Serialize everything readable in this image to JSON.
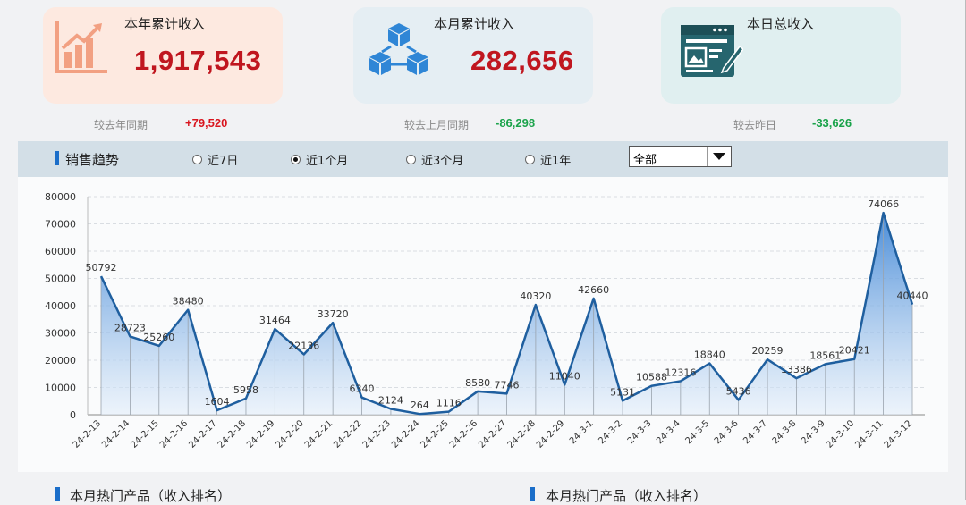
{
  "kpis": {
    "year": {
      "title": "本年累计收入",
      "value": "1,917,543",
      "cmp_label": "较去年同期",
      "cmp_value": "+79,520"
    },
    "month": {
      "title": "本月累计收入",
      "value": "282,656",
      "cmp_label": "较去上月同期",
      "cmp_value": "-86,298"
    },
    "day": {
      "title": "本日总收入",
      "value": "",
      "cmp_label": "较去昨日",
      "cmp_value": "-33,626"
    }
  },
  "colors": {
    "kpi_value": "#c0161f",
    "positive": "#d9151e",
    "negative": "#1aa34a",
    "line": "#1f5f9f",
    "accent": "#1b6ec9"
  },
  "icons": {
    "year": "bar-chart-growth-icon",
    "month": "cubes-network-icon",
    "day": "document-edit-icon"
  },
  "filter": {
    "title": "销售趋势",
    "options": [
      {
        "label": "近7日",
        "checked": false
      },
      {
        "label": "近1个月",
        "checked": true
      },
      {
        "label": "近3个月",
        "checked": false
      },
      {
        "label": "近1年",
        "checked": false
      }
    ],
    "select_value": "全部"
  },
  "chart_data": {
    "type": "area",
    "x": [
      "24-2-13",
      "24-2-14",
      "24-2-15",
      "24-2-16",
      "24-2-17",
      "24-2-18",
      "24-2-19",
      "24-2-20",
      "24-2-21",
      "24-2-22",
      "24-2-23",
      "24-2-24",
      "24-2-25",
      "24-2-26",
      "24-2-27",
      "24-2-28",
      "24-2-29",
      "24-3-1",
      "24-3-2",
      "24-3-3",
      "24-3-4",
      "24-3-5",
      "24-3-6",
      "24-3-7",
      "24-3-8",
      "24-3-9",
      "24-3-10",
      "24-3-11",
      "24-3-12"
    ],
    "values": [
      50792,
      28723,
      25260,
      38480,
      1604,
      5958,
      31464,
      22136,
      33720,
      6340,
      2124,
      264,
      1116,
      8580,
      7746,
      40320,
      11040,
      42660,
      5131,
      10588,
      12316,
      18840,
      5436,
      20259,
      13386,
      18561,
      20421,
      74066,
      40440
    ],
    "ylim": [
      0,
      80000
    ],
    "yticks": [
      0,
      10000,
      20000,
      30000,
      40000,
      50000,
      60000,
      70000,
      80000
    ],
    "grid": true,
    "data_labels": true
  },
  "bottom": {
    "left_title": "本月热门产品（收入排名）",
    "right_title": "本月热门产品（收入排名）"
  }
}
